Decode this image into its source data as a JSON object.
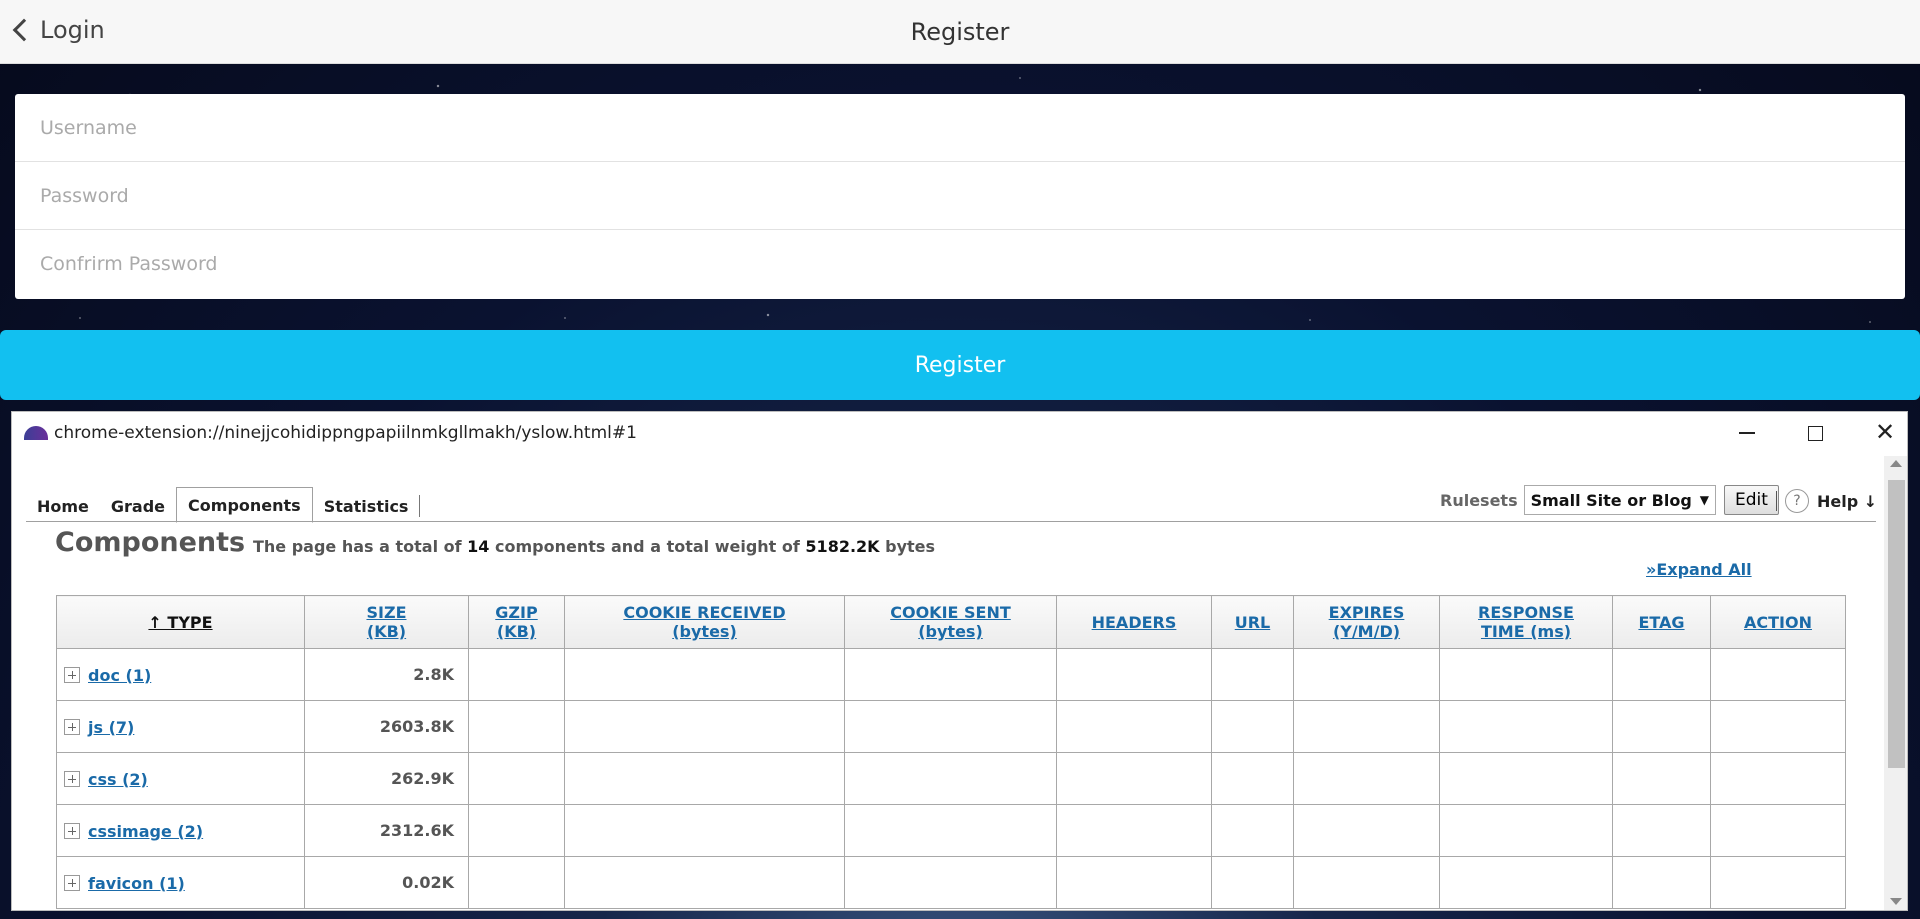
{
  "app": {
    "back_label": "Login",
    "title": "Register",
    "fields": {
      "username_placeholder": "Username",
      "password_placeholder": "Password",
      "confirm_placeholder": "Confrirm Password"
    },
    "register_button": "Register"
  },
  "popup": {
    "url": "chrome-extension://ninejjcohidippngpapiilnmkgllmakh/yslow.html#1",
    "tabs": [
      "Home",
      "Grade",
      "Components",
      "Statistics"
    ],
    "active_tab": "Components",
    "rulesets_label": "Rulesets",
    "ruleset_selected": "Small Site or Blog",
    "edit_label": "Edit",
    "help_label": "Help ↓",
    "heading": "Components",
    "summary": {
      "prefix": "The page has a total of",
      "count": "14",
      "middle": "components and a total weight of",
      "weight": "5182.2K",
      "suffix": "bytes"
    },
    "expand_all": "»Expand All",
    "table": {
      "headers": {
        "type": "↑ TYPE",
        "size": [
          "SIZE",
          "(KB)"
        ],
        "gzip": [
          "GZIP",
          "(KB)"
        ],
        "cookie_received": [
          "COOKIE RECEIVED",
          "(bytes)"
        ],
        "cookie_sent": [
          "COOKIE SENT",
          "(bytes)"
        ],
        "headers": "HEADERS",
        "url": "URL",
        "expires": [
          "EXPIRES",
          "(Y/M/D)"
        ],
        "response_time": [
          "RESPONSE",
          "TIME (ms)"
        ],
        "etag": "ETAG",
        "action": "ACTION"
      },
      "rows": [
        {
          "type": "doc (1)",
          "size": "2.8K"
        },
        {
          "type": "js (7)",
          "size": "2603.8K"
        },
        {
          "type": "css (2)",
          "size": "262.9K"
        },
        {
          "type": "cssimage (2)",
          "size": "2312.6K"
        },
        {
          "type": "favicon (1)",
          "size": "0.02K"
        }
      ]
    }
  }
}
